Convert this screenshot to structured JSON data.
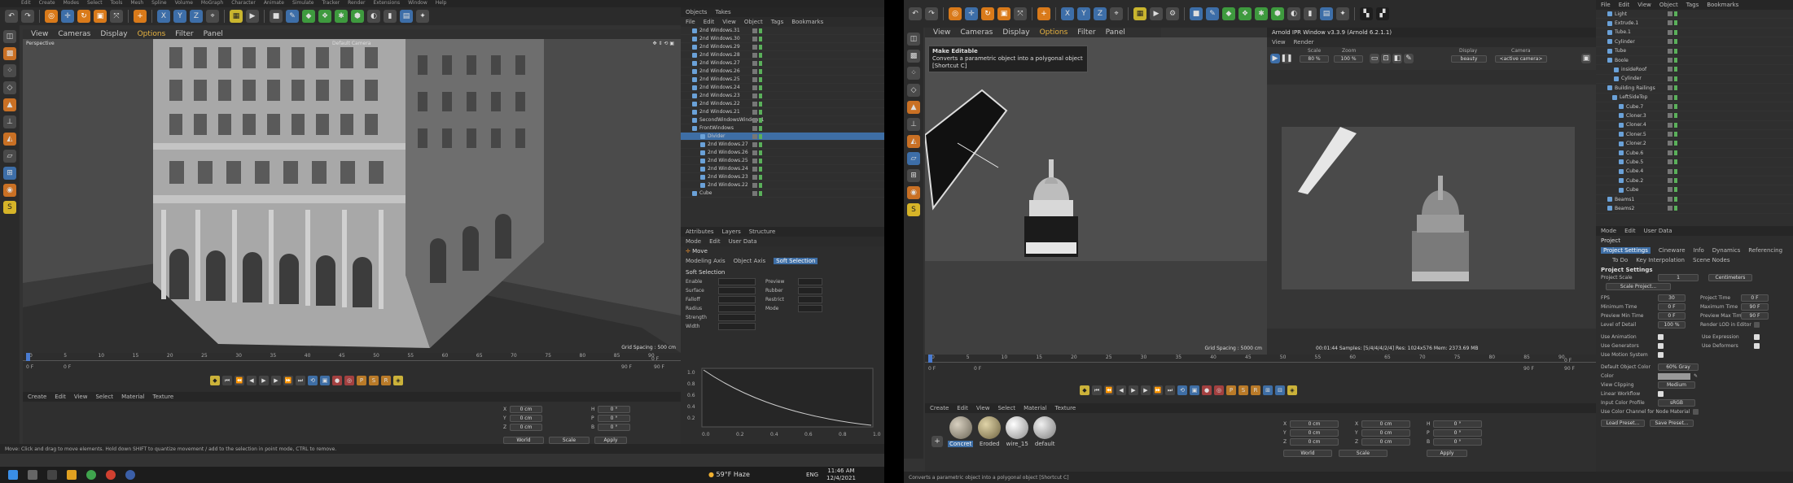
{
  "left": {
    "menu": [
      "Edit",
      "Create",
      "Modes",
      "Select",
      "Tools",
      "Mesh",
      "Spline",
      "Volume",
      "MoGraph",
      "Character",
      "Animate",
      "Simulate",
      "Tracker",
      "Render",
      "Extensions",
      "Window",
      "Help"
    ],
    "viewport_menu": [
      "View",
      "Cameras",
      "Display",
      "Options",
      "Filter",
      "Panel"
    ],
    "viewport_label": "Perspective",
    "camera_label": "Default Camera",
    "grid_spacing": "Grid Spacing : 500 cm",
    "objects_tabs": [
      "Objects",
      "Takes"
    ],
    "objects_menu": [
      "File",
      "Edit",
      "View",
      "Object",
      "Tags",
      "Bookmarks"
    ],
    "objects": [
      "2nd Windows.31",
      "2nd Windows.30",
      "2nd Windows.29",
      "2nd Windows.28",
      "2nd Windows.27",
      "2nd Windows.26",
      "2nd Windows.25",
      "2nd Windows.24",
      "2nd Windows.23",
      "2nd Windows.22",
      "2nd Windows.21",
      "SecondWindowsWindows1",
      "FrontWindows",
      "Divider",
      "2nd Windows.27",
      "2nd Windows.26",
      "2nd Windows.25",
      "2nd Windows.24",
      "2nd Windows.23",
      "2nd Windows.22",
      "Cube"
    ],
    "attr_tabs": [
      "Attributes",
      "Layers",
      "Structure"
    ],
    "attr_menu": [
      "Mode",
      "Edit",
      "User Data"
    ],
    "attr_tool": "Move",
    "attr_subtabs": [
      "Modeling Axis",
      "Object Axis",
      "Soft Selection"
    ],
    "soft_title": "Soft Selection",
    "soft_props": [
      "Enable",
      "Surface",
      "Falloff",
      "Radius",
      "Strength",
      "Width"
    ],
    "soft_right": [
      "Preview",
      "Rubber",
      "Restrict",
      "Mode"
    ],
    "graph_ticks": [
      "0.0",
      "0.2",
      "0.4",
      "0.6",
      "0.8",
      "1.0"
    ],
    "graph_y": [
      "1.0",
      "0.8",
      "0.6",
      "0.4",
      "0.2"
    ],
    "ruler": [
      "0",
      "5",
      "10",
      "15",
      "20",
      "25",
      "30",
      "35",
      "40",
      "45",
      "50",
      "55",
      "60",
      "65",
      "70",
      "75",
      "80",
      "85",
      "90"
    ],
    "time_start": "0 F",
    "time_cur": "0 F",
    "time_end": "90 F",
    "time_end2": "90 F",
    "frame_right": "0 F",
    "mat_menu": [
      "Create",
      "Edit",
      "View",
      "Select",
      "Material",
      "Texture"
    ],
    "coord": [
      "X",
      "Y",
      "Z"
    ],
    "coord_right": [
      "H",
      "P",
      "B"
    ],
    "coord_vals": "0 cm",
    "coord_deg": "0 °",
    "world": "World",
    "scale": "Scale",
    "apply": "Apply",
    "status": "Move: Click and drag to move elements. Hold down SHIFT to quantize movement / add to the selection in point mode, CTRL to remove.",
    "weather": "59°F Haze",
    "lang": "ENG",
    "clock_time": "11:46 AM",
    "clock_date": "12/4/2021"
  },
  "right": {
    "menu": [
      "File",
      "Edit",
      "View",
      "Object",
      "Tags",
      "Bookmarks"
    ],
    "viewport_menu": [
      "View",
      "Cameras",
      "Display",
      "Options",
      "Filter",
      "Panel"
    ],
    "tooltip_title": "Make Editable",
    "tooltip_body": "Converts a parametric object into a polygonal object",
    "tooltip_shortcut": "[Shortcut C]",
    "grid_spacing": "Grid Spacing : 5000 cm",
    "ipr_title": "Arnold IPR Window v3.3.9 (Arnold 6.2.1.1)",
    "ipr_menu": [
      "View",
      "Render"
    ],
    "ipr_scale_label": "Scale",
    "ipr_scale": "80 %",
    "ipr_zoom_label": "Zoom",
    "ipr_zoom": "100 %",
    "ipr_display_label": "Display",
    "ipr_display": "beauty",
    "ipr_camera_label": "Camera",
    "ipr_camera": "<active camera>",
    "ipr_status": "00:01:44  Samples: [5/4/4/4/2/4]  Res: 1024x576  Mem: 2373.69 MB",
    "objects": [
      "Light",
      "Extrude.1",
      "Tube.1",
      "Cylinder",
      "Tube",
      "Boole",
      "insideRoof",
      "Cylinder",
      "Building Railings",
      "LeftSideTop",
      "Cube.7",
      "Cloner.3",
      "Cloner.4",
      "Cloner.5",
      "Cloner.2",
      "Cube.6",
      "Cube.5",
      "Cube.4",
      "Cube.2",
      "Cube",
      "Beams1",
      "Beams2"
    ],
    "attr_menu": [
      "Mode",
      "Edit",
      "User Data"
    ],
    "attr_title": "Project",
    "attr_tabs": [
      "Project Settings",
      "Cineware",
      "Info",
      "Dynamics",
      "Referencing"
    ],
    "attr_tabs2": [
      "To Do",
      "Key Interpolation",
      "Scene Nodes"
    ],
    "section": "Project Settings",
    "project_scale_label": "Project Scale",
    "project_scale": "1",
    "project_units": "Centimeters",
    "scale_btn": "Scale Project...",
    "fps_label": "FPS",
    "fps": "30",
    "ptime_label": "Project Time",
    "ptime": "0 F",
    "mintime_label": "Minimum Time",
    "mintime": "0 F",
    "maxtime_label": "Maximum Time",
    "maxtime": "90 F",
    "pmin_label": "Preview Min Time",
    "pmin": "0 F",
    "pmax_label": "Preview Max Time",
    "pmax": "90 F",
    "lod_label": "Level of Detail",
    "lod": "100 %",
    "render_lod": "Render LOD in Editor",
    "checks_left": [
      "Use Animation",
      "Use Generators",
      "Use Motion System"
    ],
    "checks_right": [
      "Use Expression",
      "Use Deformers"
    ],
    "def_color_label": "Default Object Color",
    "def_color": "60% Gray",
    "color_label": "Color",
    "clipping_label": "View Clipping",
    "clipping": "Medium",
    "linear_label": "Linear Workflow",
    "profile_label": "Input Color Profile",
    "profile": "sRGB",
    "node_label": "Use Color Channel for Node Material",
    "load_btn": "Load Preset...",
    "save_btn": "Save Preset...",
    "ruler": [
      "0",
      "5",
      "10",
      "15",
      "20",
      "25",
      "30",
      "35",
      "40",
      "45",
      "50",
      "55",
      "60",
      "65",
      "70",
      "75",
      "80",
      "85",
      "90"
    ],
    "time_start": "0 F",
    "time_cur": "0 F",
    "time_end": "90 F",
    "time_end2": "90 F",
    "frame_right": "0 F",
    "mat_menu": [
      "Create",
      "Edit",
      "View",
      "Select",
      "Material",
      "Texture"
    ],
    "materials": [
      "Concret",
      "Eroded",
      "wire_15",
      "default"
    ],
    "coord": [
      "X",
      "Y",
      "Z"
    ],
    "coord_mid": [
      "X",
      "Y",
      "Z"
    ],
    "coord_right": [
      "H",
      "P",
      "B"
    ],
    "coord_vals": "0 cm",
    "coord_deg": "0 °",
    "world": "World",
    "scale": "Scale",
    "apply": "Apply",
    "status": "Converts a parametric object into a polygonal object [Shortcut C]"
  }
}
